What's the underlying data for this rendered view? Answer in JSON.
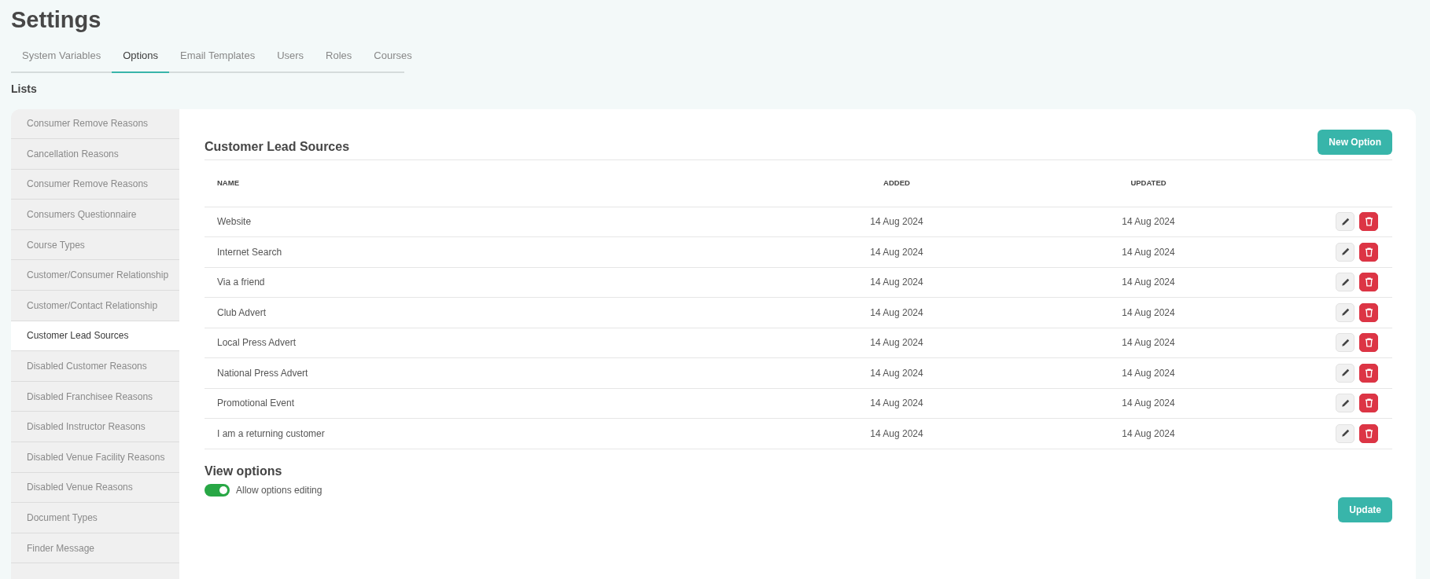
{
  "page_title": "Settings",
  "tabs": [
    {
      "label": "System Variables",
      "selected": false
    },
    {
      "label": "Options",
      "selected": true
    },
    {
      "label": "Email Templates",
      "selected": false
    },
    {
      "label": "Users",
      "selected": false
    },
    {
      "label": "Roles",
      "selected": false
    },
    {
      "label": "Courses",
      "selected": false
    }
  ],
  "section_title": "Lists",
  "sidebar": {
    "items": [
      {
        "label": "Consumer Remove Reasons",
        "selected": false
      },
      {
        "label": "Cancellation Reasons",
        "selected": false
      },
      {
        "label": "Consumer Remove Reasons",
        "selected": false
      },
      {
        "label": "Consumers Questionnaire",
        "selected": false
      },
      {
        "label": "Course Types",
        "selected": false
      },
      {
        "label": "Customer/Consumer Relationship",
        "selected": false
      },
      {
        "label": "Customer/Contact Relationship",
        "selected": false
      },
      {
        "label": "Customer Lead Sources",
        "selected": true
      },
      {
        "label": "Disabled Customer Reasons",
        "selected": false
      },
      {
        "label": "Disabled Franchisee Reasons",
        "selected": false
      },
      {
        "label": "Disabled Instructor Reasons",
        "selected": false
      },
      {
        "label": "Disabled Venue Facility Reasons",
        "selected": false
      },
      {
        "label": "Disabled Venue Reasons",
        "selected": false
      },
      {
        "label": "Document Types",
        "selected": false
      },
      {
        "label": "Finder Message",
        "selected": false
      }
    ]
  },
  "panel": {
    "title": "Customer Lead Sources",
    "new_button": "New Option"
  },
  "table": {
    "columns": [
      "NAME",
      "ADDED",
      "UPDATED"
    ],
    "rows": [
      {
        "name": "Website",
        "added": "14 Aug 2024",
        "updated": "14 Aug 2024"
      },
      {
        "name": "Internet Search",
        "added": "14 Aug 2024",
        "updated": "14 Aug 2024"
      },
      {
        "name": "Via a friend",
        "added": "14 Aug 2024",
        "updated": "14 Aug 2024"
      },
      {
        "name": "Club Advert",
        "added": "14 Aug 2024",
        "updated": "14 Aug 2024"
      },
      {
        "name": "Local Press Advert",
        "added": "14 Aug 2024",
        "updated": "14 Aug 2024"
      },
      {
        "name": "National Press Advert",
        "added": "14 Aug 2024",
        "updated": "14 Aug 2024"
      },
      {
        "name": "Promotional Event",
        "added": "14 Aug 2024",
        "updated": "14 Aug 2024"
      },
      {
        "name": "I am a returning customer",
        "added": "14 Aug 2024",
        "updated": "14 Aug 2024"
      }
    ]
  },
  "view_options": {
    "title": "View options",
    "toggle": {
      "label": "Allow options editing",
      "on": true
    },
    "update_button": "Update"
  }
}
